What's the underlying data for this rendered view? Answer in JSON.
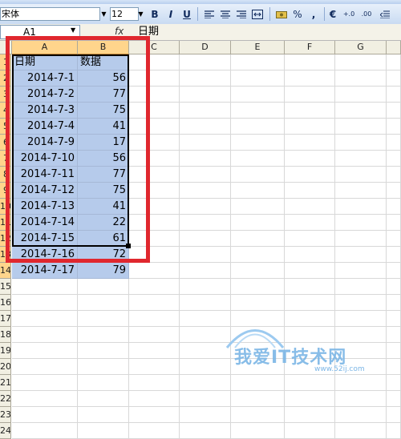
{
  "toolbar": {
    "font_name": "宋体",
    "font_size": "12",
    "bold_label": "B",
    "italic_label": "I",
    "underline_label": "U",
    "percent_label": "%",
    "comma_label": ",",
    "euro_label": "€",
    "inc_decimal_label": "+.0",
    "dec_decimal_label": ".00"
  },
  "formula_bar": {
    "name_box": "A1",
    "fx_label": "fx",
    "value": "日期"
  },
  "columns": [
    "A",
    "B",
    "C",
    "D",
    "E",
    "F",
    "G"
  ],
  "rows": [
    "1",
    "2",
    "3",
    "4",
    "5",
    "6",
    "7",
    "8",
    "9",
    "10",
    "11",
    "12",
    "13",
    "14",
    "15",
    "16",
    "17",
    "18",
    "19",
    "20",
    "21",
    "22",
    "23",
    "24"
  ],
  "table": {
    "headers": [
      "日期",
      "数据"
    ],
    "data": [
      [
        "2014-7-1",
        "56"
      ],
      [
        "2014-7-2",
        "77"
      ],
      [
        "2014-7-3",
        "75"
      ],
      [
        "2014-7-4",
        "41"
      ],
      [
        "2014-7-9",
        "17"
      ],
      [
        "2014-7-10",
        "56"
      ],
      [
        "2014-7-11",
        "77"
      ],
      [
        "2014-7-12",
        "75"
      ],
      [
        "2014-7-13",
        "41"
      ],
      [
        "2014-7-14",
        "22"
      ],
      [
        "2014-7-15",
        "61"
      ],
      [
        "2014-7-16",
        "72"
      ],
      [
        "2014-7-17",
        "79"
      ]
    ]
  },
  "watermark": {
    "text": "我爱IT技术网",
    "sub": "www.52ij.com"
  },
  "colors": {
    "selection_fill": "#b6cbeb",
    "highlight_frame": "#e0272e",
    "selected_header": "#ffd58c"
  }
}
